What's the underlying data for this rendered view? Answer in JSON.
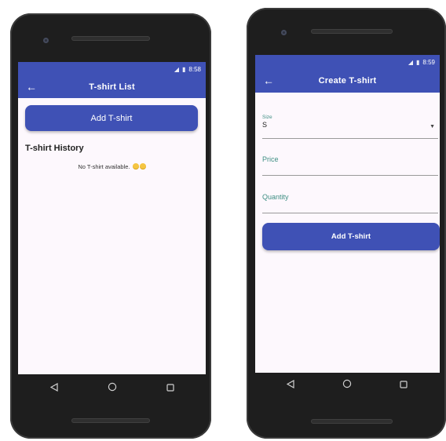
{
  "left_screen": {
    "status_time": "8:58",
    "title": "T-shirt List",
    "add_button_label": "Add T-shirt",
    "history_title": "T-shirt History",
    "empty_message": "No T-shirt available.",
    "back_icon": "arrow-left-icon"
  },
  "right_screen": {
    "status_time": "8:59",
    "title": "Create T-shirt",
    "size_field": {
      "label": "Size",
      "value": "S"
    },
    "price_field": {
      "label": "Price",
      "value": ""
    },
    "quantity_field": {
      "label": "Quantity",
      "value": ""
    },
    "add_button_label": "Add T-shirt",
    "back_icon": "arrow-left-icon"
  },
  "colors": {
    "app_bar": "#3f51b5",
    "screen_background": "#fdf8fd",
    "field_label": "#3f8f84",
    "phone_body": "#1e1e1e"
  }
}
